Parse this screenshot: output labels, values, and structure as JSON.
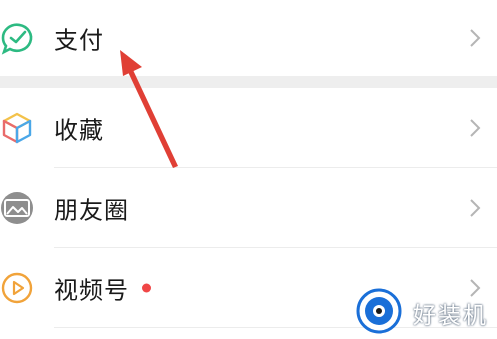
{
  "menu": {
    "items": [
      {
        "label": "支付",
        "icon": "wechat-pay-icon"
      },
      {
        "label": "收藏",
        "icon": "favorites-cube-icon"
      },
      {
        "label": "朋友圈",
        "icon": "moments-photo-icon"
      },
      {
        "label": "视频号",
        "icon": "channels-play-icon",
        "badge": "red-dot"
      }
    ]
  },
  "watermark": {
    "text": "好装机"
  },
  "colors": {
    "pay_green": "#2dba82",
    "arrow_red": "#e03f35",
    "badge_red": "#f04646",
    "channels_orange": "#f1a33a",
    "watermark_blue": "#1a6fd8"
  }
}
